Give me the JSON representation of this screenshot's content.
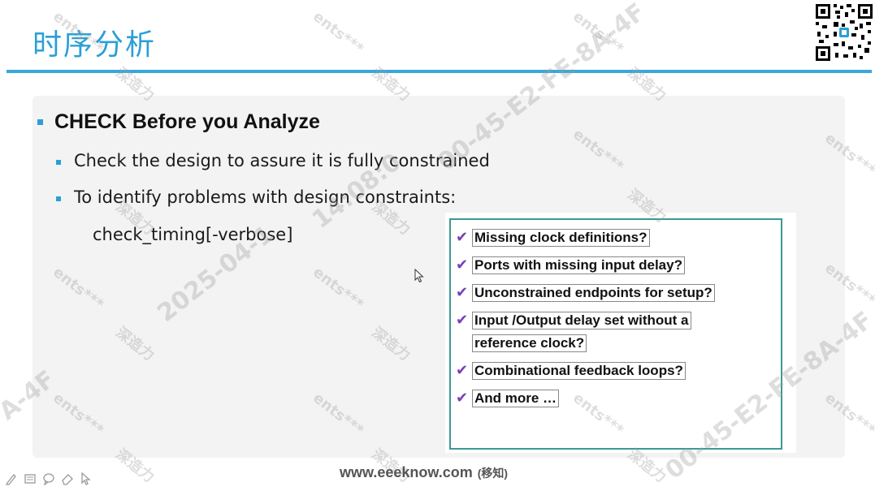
{
  "slide": {
    "title": "时序分析"
  },
  "content": {
    "heading": "CHECK Before you Analyze",
    "bullets": [
      "Check the design to assure it is fully constrained",
      "To identify problems with design constraints:"
    ],
    "command": "check_timing[-verbose]"
  },
  "checklist": {
    "items": [
      "Missing clock definitions?",
      "Ports with missing input delay?",
      "Unconstrained endpoints for setup?",
      "Input /Output delay set without a",
      "reference clock?",
      "Combinational feedback loops?",
      "And more …"
    ]
  },
  "watermarks": {
    "brand": "ents***",
    "cn": "深造力",
    "date": "2025-04-1",
    "id": "00-45-E2-FE-8A-4F",
    "time": "14:08:0",
    "fragment": "A-4F"
  },
  "footer": {
    "url": "www.eeeknow.com",
    "note": "(移知)"
  },
  "colors": {
    "accent": "#2a9fd6",
    "check": "#7a3fb8",
    "box_border": "#3a9a93"
  },
  "icons": [
    "pen-icon",
    "slides-icon",
    "comment-icon",
    "eraser-icon",
    "pointer-icon",
    "qr-code-icon",
    "cursor-icon"
  ]
}
